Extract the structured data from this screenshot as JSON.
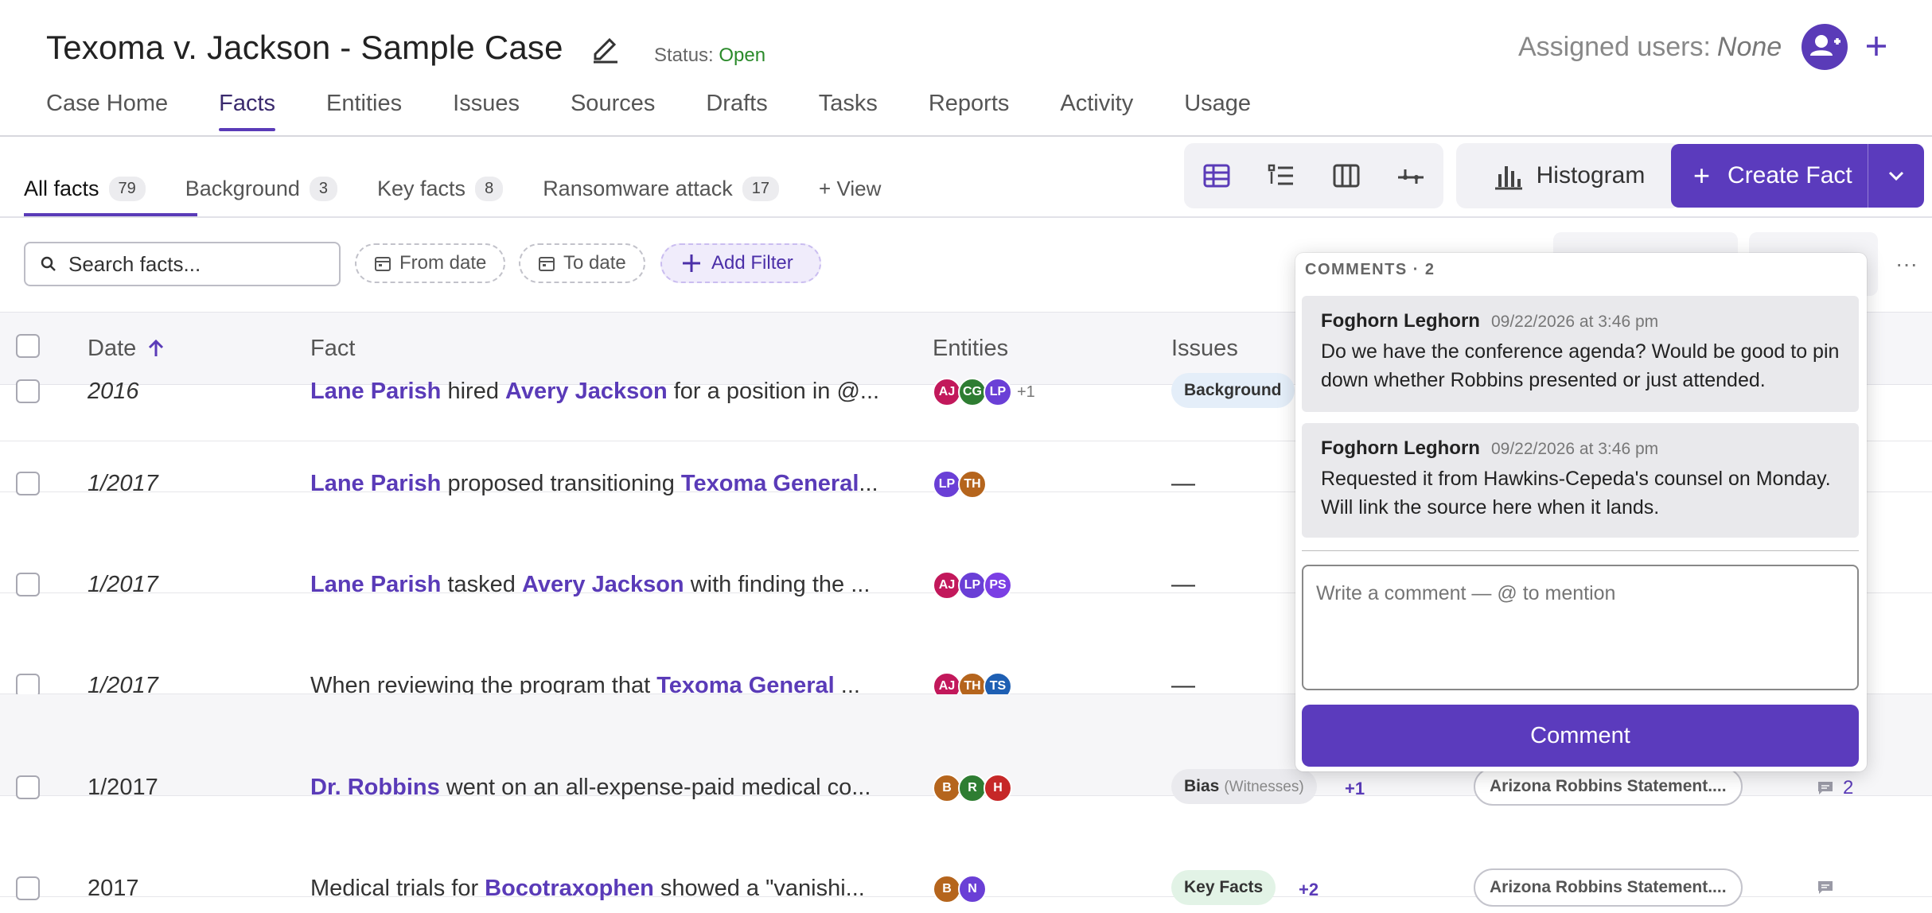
{
  "case": {
    "title": "Texoma v. Jackson - Sample Case",
    "status_label": "Status:",
    "status_value": "Open"
  },
  "assigned": {
    "label": "Assigned users:",
    "value": "None"
  },
  "nav": [
    {
      "label": "Case Home"
    },
    {
      "label": "Facts",
      "active": true
    },
    {
      "label": "Entities"
    },
    {
      "label": "Issues"
    },
    {
      "label": "Sources"
    },
    {
      "label": "Drafts"
    },
    {
      "label": "Tasks"
    },
    {
      "label": "Reports"
    },
    {
      "label": "Activity"
    },
    {
      "label": "Usage"
    }
  ],
  "views": [
    {
      "label": "All facts",
      "count": "79",
      "active": true
    },
    {
      "label": "Background",
      "count": "3"
    },
    {
      "label": "Key facts",
      "count": "8"
    },
    {
      "label": "Ransomware attack",
      "count": "17"
    }
  ],
  "add_view_label": "+ View",
  "toolbar": {
    "view_icons": [
      "table-icon",
      "list-icon",
      "columns-icon",
      "timeline-icon"
    ],
    "histogram_label": "Histogram",
    "create_label": "Create Fact"
  },
  "filters": {
    "search_placeholder": "Search facts...",
    "from_date": "From date",
    "to_date": "To date",
    "add_filter": "Add Filter"
  },
  "columns": {
    "date": "Date",
    "fact": "Fact",
    "entities": "Entities",
    "issues": "Issues"
  },
  "rows": [
    {
      "date": "2016",
      "italic": true,
      "fact": [
        {
          "t": "Lane Parish",
          "e": true
        },
        {
          "t": " hired "
        },
        {
          "t": "Avery Jackson",
          "e": true
        },
        {
          "t": " for a position in @..."
        }
      ],
      "avatars": [
        {
          "i": "AJ",
          "c": "#c2185b"
        },
        {
          "i": "CG",
          "c": "#2e7d32"
        },
        {
          "i": "LP",
          "c": "#6a3fd6"
        }
      ],
      "more": "+1",
      "issue": {
        "label": "Background",
        "style": "blue"
      }
    },
    {
      "date": "1/2017",
      "italic": true,
      "fact": [
        {
          "t": "Lane Parish",
          "e": true
        },
        {
          "t": " proposed transitioning "
        },
        {
          "t": "Texoma General",
          "e": true
        },
        {
          "t": "..."
        }
      ],
      "avatars": [
        {
          "i": "LP",
          "c": "#6a3fd6"
        },
        {
          "i": "TH",
          "c": "#b5651d"
        }
      ],
      "issue_dash": "—"
    },
    {
      "date": "1/2017",
      "italic": true,
      "fact": [
        {
          "t": "Lane Parish",
          "e": true
        },
        {
          "t": " tasked "
        },
        {
          "t": "Avery Jackson",
          "e": true
        },
        {
          "t": " with finding the ..."
        }
      ],
      "avatars": [
        {
          "i": "AJ",
          "c": "#c2185b"
        },
        {
          "i": "LP",
          "c": "#6a3fd6"
        },
        {
          "i": "PS",
          "c": "#7b3fe4"
        }
      ],
      "issue_dash": "—"
    },
    {
      "date": "1/2017",
      "italic": true,
      "fact": [
        {
          "t": "When reviewing the program that "
        },
        {
          "t": "Texoma General",
          "e": true
        },
        {
          "t": " ..."
        }
      ],
      "avatars": [
        {
          "i": "AJ",
          "c": "#c2185b"
        },
        {
          "i": "TH",
          "c": "#b5651d"
        },
        {
          "i": "TS",
          "c": "#1e5fb3"
        }
      ],
      "issue_dash": "—"
    },
    {
      "date": "1/2017",
      "italic": false,
      "highlight": true,
      "fact": [
        {
          "t": "Dr. Robbins",
          "e": true
        },
        {
          "t": " went on an all-expense-paid medical co..."
        }
      ],
      "avatars": [
        {
          "i": "B",
          "c": "#b5651d"
        },
        {
          "i": "R",
          "c": "#2e7d32"
        },
        {
          "i": "H",
          "c": "#c62828"
        }
      ],
      "issue": {
        "label": "Bias",
        "sub": "(Witnesses)",
        "style": "gray"
      },
      "issue_more": "+1",
      "source": "Arizona Robbins Statement....",
      "comments": "2"
    },
    {
      "date": "2017",
      "italic": false,
      "fact": [
        {
          "t": "Medical trials for "
        },
        {
          "t": "Bocotraxophen",
          "e": true
        },
        {
          "t": " showed a \"vanishi..."
        }
      ],
      "avatars": [
        {
          "i": "B",
          "c": "#b5651d"
        },
        {
          "i": "N",
          "c": "#6a3fd6"
        }
      ],
      "issue": {
        "label": "Key Facts",
        "style": "green"
      },
      "issue_more": "+2",
      "source": "Arizona Robbins Statement....",
      "comments": ""
    }
  ],
  "comments_popover": {
    "header": "COMMENTS · 2",
    "comments": [
      {
        "author": "Foghorn Leghorn",
        "time": "09/22/2026 at 3:46 pm",
        "text": "Do we have the conference agenda? Would be good to pin down whether Robbins presented or just attended."
      },
      {
        "author": "Foghorn Leghorn",
        "time": "09/22/2026 at 3:46 pm",
        "text": "Requested it from Hawkins-Cepeda's counsel on Monday. Will link the source here when it lands."
      }
    ],
    "input_placeholder": "Write a comment — @ to mention",
    "submit_label": "Comment"
  },
  "colors": {
    "accent": "#5b3bbd",
    "status_open": "#2a8a2a"
  }
}
